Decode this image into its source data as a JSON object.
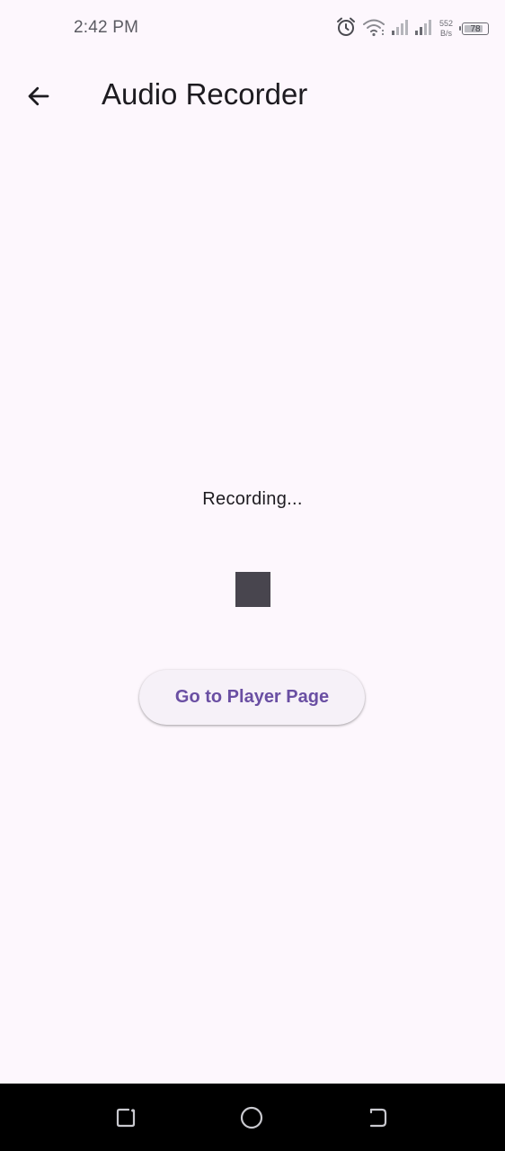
{
  "status_bar": {
    "time": "2:42 PM",
    "net_speed_value": "552",
    "net_speed_unit": "B/s",
    "battery_level": "78",
    "icons": [
      "alarm-icon",
      "wifi-icon",
      "signal-icon",
      "signal-icon"
    ]
  },
  "app_bar": {
    "title": "Audio Recorder",
    "back_icon": "arrow-back-icon"
  },
  "main": {
    "status_text": "Recording...",
    "stop_icon": "stop-icon",
    "player_button_label": "Go to Player Page"
  },
  "nav_bar": {
    "icons": [
      "recents-icon",
      "home-icon",
      "back-icon"
    ]
  },
  "colors": {
    "background": "#fdf7fd",
    "primary": "#6a4fa3",
    "stop": "#48454e",
    "button_bg": "#f6f1f8",
    "nav_bar": "#000000"
  }
}
